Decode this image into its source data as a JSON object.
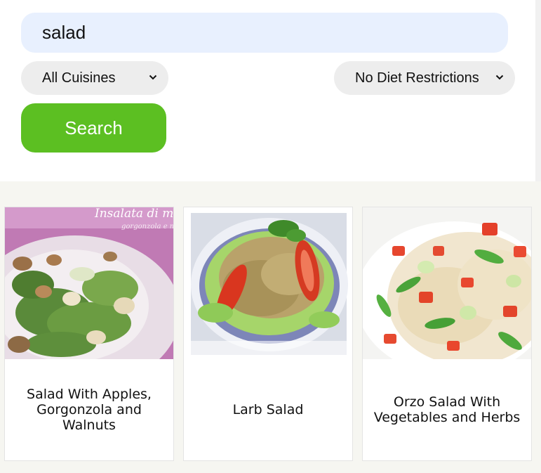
{
  "search": {
    "query": "salad",
    "cuisine_selected": "All Cuisines",
    "diet_selected": "No Diet Restrictions",
    "button_label": "Search"
  },
  "results": [
    {
      "title": "Salad With Apples, Gorgonzola and Walnuts",
      "image_caption": "Insalata di me",
      "image_subcaption": "gorgonzola e no"
    },
    {
      "title": "Larb Salad"
    },
    {
      "title": "Orzo Salad With Vegetables and Herbs"
    }
  ],
  "colors": {
    "search_bg": "#e8f0fe",
    "button_green": "#5cbf22",
    "results_bg": "#f6f6f1"
  }
}
